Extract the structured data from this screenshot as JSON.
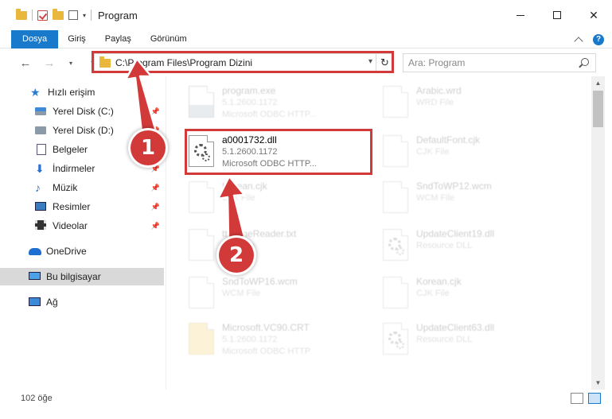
{
  "window": {
    "title": "Program",
    "minimize_glyph": "—",
    "close_glyph": "✕"
  },
  "ribbon": {
    "tabs": [
      {
        "label": "Dosya"
      },
      {
        "label": "Giriş"
      },
      {
        "label": "Paylaş"
      },
      {
        "label": "Görünüm"
      }
    ]
  },
  "nav": {
    "address": "C:\\Program Files\\Program Dizini",
    "search_placeholder": "Ara: Program"
  },
  "sidebar": {
    "items": [
      {
        "label": "Hızlı erişim",
        "icon": "star-icon"
      },
      {
        "label": "Yerel Disk (C:)",
        "icon": "disk-icon",
        "pinned": true
      },
      {
        "label": "Yerel Disk (D:)",
        "icon": "disk-icon",
        "pinned": true
      },
      {
        "label": "Belgeler",
        "icon": "documents-icon",
        "pinned": true
      },
      {
        "label": "İndirmeler",
        "icon": "download-icon",
        "pinned": true
      },
      {
        "label": "Müzik",
        "icon": "music-icon",
        "pinned": true
      },
      {
        "label": "Resimler",
        "icon": "pictures-icon",
        "pinned": true
      },
      {
        "label": "Videolar",
        "icon": "videos-icon",
        "pinned": true
      },
      {
        "label": "OneDrive",
        "icon": "onedrive-icon"
      },
      {
        "label": "Bu bilgisayar",
        "icon": "computer-icon",
        "selected": true
      },
      {
        "label": "Ağ",
        "icon": "network-icon"
      }
    ]
  },
  "files": [
    {
      "name": "program.exe",
      "line2": "5.1.2600.1172",
      "line3": "Microsoft ODBC HTTP...",
      "faded": true,
      "icon": "exe"
    },
    {
      "name": "Arabic.wrd",
      "line2": "WRD File",
      "line3": "",
      "faded": true,
      "icon": "doc"
    },
    {
      "name": "a0001732.dll",
      "line2": "5.1.2600.1172",
      "line3": "Microsoft ODBC HTTP...",
      "faded": false,
      "icon": "dll"
    },
    {
      "name": "DefaultFont.cjk",
      "line2": "CJK File",
      "line3": "",
      "faded": true,
      "icon": "doc"
    },
    {
      "name": "Korean.cjk",
      "line2": "CJK File",
      "line3": "",
      "faded": true,
      "icon": "doc"
    },
    {
      "name": "SndToWP12.wcm",
      "line2": "WCM File",
      "line3": "",
      "faded": true,
      "icon": "doc"
    },
    {
      "name": "ttfs.fineReader.txt",
      "line2": "TXT File",
      "line3": "",
      "faded": true,
      "icon": "doc"
    },
    {
      "name": "UpdateClient19.dll",
      "line2": "Resource DLL",
      "line3": "",
      "faded": true,
      "icon": "dll"
    },
    {
      "name": "SndToWP16.wcm",
      "line2": "WCM File",
      "line3": "",
      "faded": true,
      "icon": "doc"
    },
    {
      "name": "Korean.cjk",
      "line2": "CJK File",
      "line3": "",
      "faded": true,
      "icon": "doc"
    },
    {
      "name": "Microsoft.VC90.CRT",
      "line2": "5.1.2600.1172",
      "line3": "Microsoft ODBC HTTP",
      "faded": true,
      "icon": "folder"
    },
    {
      "name": "UpdateClient63.dll",
      "line2": "Resource DLL",
      "line3": "",
      "faded": true,
      "icon": "dll"
    }
  ],
  "status": {
    "item_count": "102 öğe"
  },
  "callouts": [
    "1",
    "2"
  ],
  "colors": {
    "accent": "#1979ca",
    "highlight_red": "#d23a3a"
  }
}
